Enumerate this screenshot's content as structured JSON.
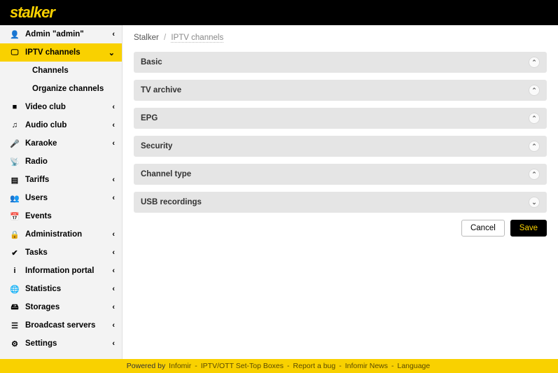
{
  "logo": "stalker",
  "sidebar": {
    "items": [
      {
        "icon": "👤",
        "label": "Admin \"admin\"",
        "chev": "‹"
      },
      {
        "icon": "🖵",
        "label": "IPTV channels",
        "chev": "⌄",
        "active": true
      },
      {
        "icon": "",
        "label": "Channels",
        "sub": true
      },
      {
        "icon": "",
        "label": "Organize channels",
        "sub": true
      },
      {
        "icon": "■",
        "label": "Video club",
        "chev": "‹"
      },
      {
        "icon": "♫",
        "label": "Audio club",
        "chev": "‹"
      },
      {
        "icon": "🎤",
        "label": "Karaoke",
        "chev": "‹"
      },
      {
        "icon": "📡",
        "label": "Radio",
        "chev": ""
      },
      {
        "icon": "▤",
        "label": "Tariffs",
        "chev": "‹"
      },
      {
        "icon": "👥",
        "label": "Users",
        "chev": "‹"
      },
      {
        "icon": "📅",
        "label": "Events",
        "chev": ""
      },
      {
        "icon": "🔒",
        "label": "Administration",
        "chev": "‹"
      },
      {
        "icon": "✔",
        "label": "Tasks",
        "chev": "‹"
      },
      {
        "icon": "i",
        "label": "Information portal",
        "chev": "‹"
      },
      {
        "icon": "🌐",
        "label": "Statistics",
        "chev": "‹"
      },
      {
        "icon": "🖴",
        "label": "Storages",
        "chev": "‹"
      },
      {
        "icon": "☰",
        "label": "Broadcast servers",
        "chev": "‹"
      },
      {
        "icon": "⚙",
        "label": "Settings",
        "chev": "‹"
      }
    ]
  },
  "breadcrumb": {
    "root": "Stalker",
    "current": "IPTV channels"
  },
  "panels": [
    {
      "title": "Basic",
      "open": true
    },
    {
      "title": "TV archive",
      "open": true
    },
    {
      "title": "EPG",
      "open": true
    },
    {
      "title": "Security",
      "open": true
    },
    {
      "title": "Channel type",
      "open": true
    },
    {
      "title": "USB recordings",
      "open": false
    }
  ],
  "buttons": {
    "cancel": "Cancel",
    "save": "Save"
  },
  "footer": {
    "prefix": "Powered by",
    "links": [
      "Infomir",
      "IPTV/OTT Set-Top Boxes",
      "Report a bug",
      "Infomir News",
      "Language"
    ]
  }
}
